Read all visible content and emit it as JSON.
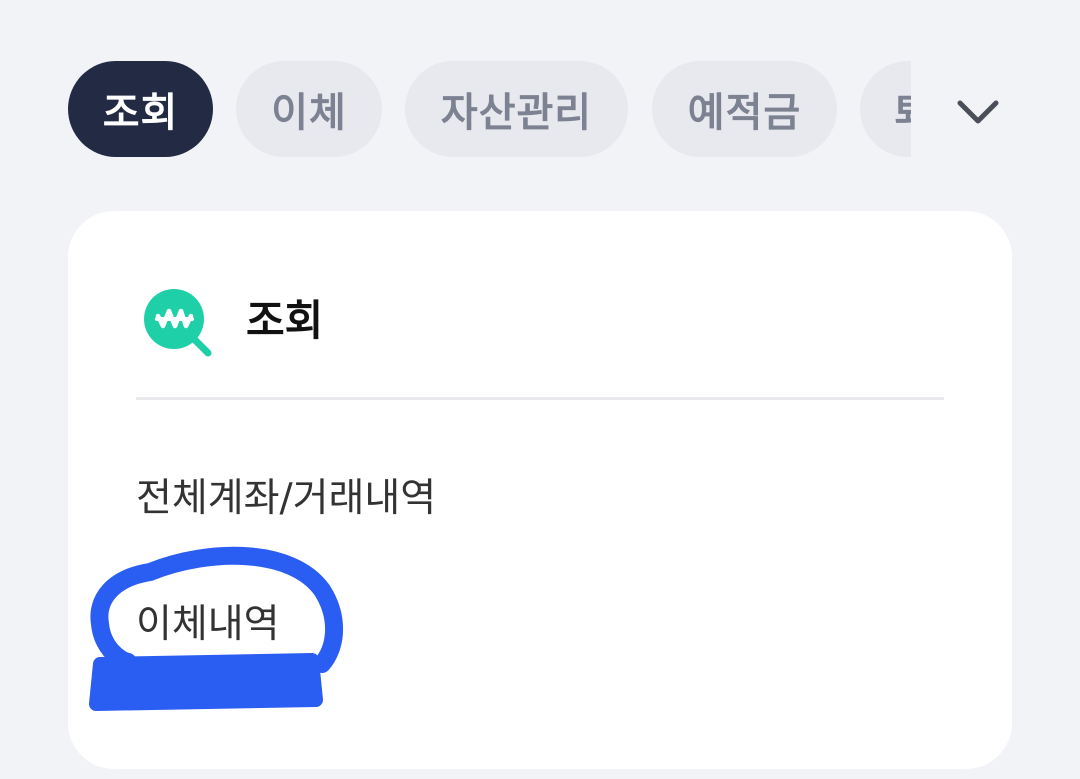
{
  "tabs": {
    "items": [
      {
        "label": "조회",
        "active": true
      },
      {
        "label": "이체",
        "active": false
      },
      {
        "label": "자산관리",
        "active": false
      },
      {
        "label": "예적금",
        "active": false
      },
      {
        "label": "퇴",
        "active": false
      }
    ],
    "expand_icon": "chevron-down-icon"
  },
  "card": {
    "icon": "won-search-icon",
    "title": "조회",
    "links": [
      "전체계좌/거래내역",
      "이체내역"
    ]
  },
  "annotation": {
    "type": "hand-drawn-circle",
    "color": "#2a5df2",
    "highlighted_item": "이체내역"
  },
  "colors": {
    "background": "#f2f3f6",
    "active_chip": "#232a43",
    "inactive_chip": "#e7e9ee",
    "inactive_chip_text": "#7c8291",
    "brand_teal": "#1fcfa8"
  }
}
